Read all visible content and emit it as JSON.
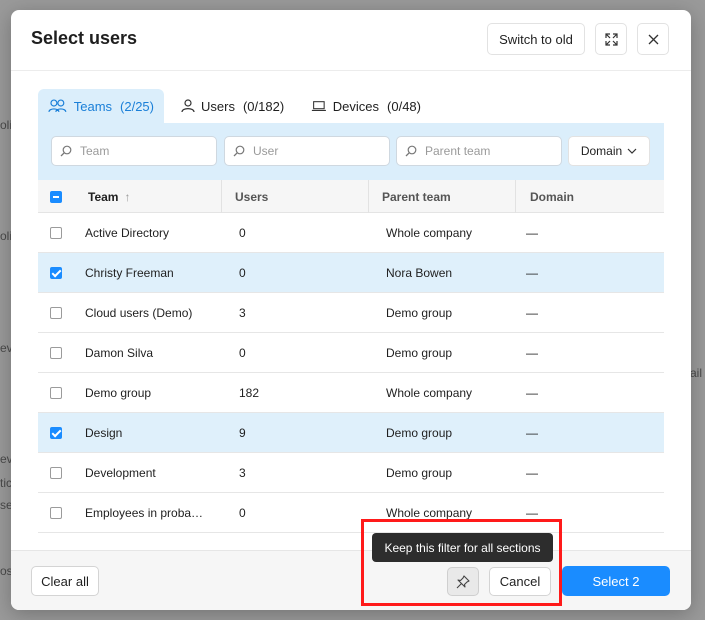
{
  "dialog": {
    "title": "Select users",
    "switch_label": "Switch to old"
  },
  "background_fragments": [
    "olic",
    "olic",
    "evic",
    "ail",
    "evic",
    "tic",
    "se",
    "os"
  ],
  "tabs": [
    {
      "label": "Teams",
      "count": "(2/25)",
      "icon": "teams-icon",
      "active": true
    },
    {
      "label": "Users",
      "count": "(0/182)",
      "icon": "user-icon",
      "active": false
    },
    {
      "label": "Devices",
      "count": "(0/48)",
      "icon": "laptop-icon",
      "active": false
    }
  ],
  "filters": {
    "team_placeholder": "Team",
    "user_placeholder": "User",
    "parent_team_placeholder": "Parent team",
    "domain_label": "Domain"
  },
  "table": {
    "columns": [
      "Team",
      "Users",
      "Parent team",
      "Domain"
    ],
    "sort_indicator": "↑",
    "rows": [
      {
        "team": "Active Directory",
        "users": "0",
        "parent": "Whole company",
        "domain": "—",
        "checked": false
      },
      {
        "team": "Christy Freeman",
        "users": "0",
        "parent": "Nora Bowen",
        "domain": "—",
        "checked": true
      },
      {
        "team": "Cloud users (Demo)",
        "users": "3",
        "parent": "Demo group",
        "domain": "—",
        "checked": false
      },
      {
        "team": "Damon Silva",
        "users": "0",
        "parent": "Demo group",
        "domain": "—",
        "checked": false
      },
      {
        "team": "Demo group",
        "users": "182",
        "parent": "Whole company",
        "domain": "—",
        "checked": false
      },
      {
        "team": "Design",
        "users": "9",
        "parent": "Demo group",
        "domain": "—",
        "checked": true
      },
      {
        "team": "Development",
        "users": "3",
        "parent": "Demo group",
        "domain": "—",
        "checked": false
      },
      {
        "team": "Employees in proba…",
        "users": "0",
        "parent": "Whole company",
        "domain": "—",
        "checked": false
      }
    ]
  },
  "footer": {
    "clear_label": "Clear all",
    "cancel_label": "Cancel",
    "select_label": "Select 2",
    "tooltip": "Keep this filter for all sections"
  },
  "colors": {
    "accent": "#1a8cff",
    "tab_active_bg": "#dbeefb",
    "selected_row_bg": "#dff0fb",
    "highlight": "#ff1a1a"
  }
}
